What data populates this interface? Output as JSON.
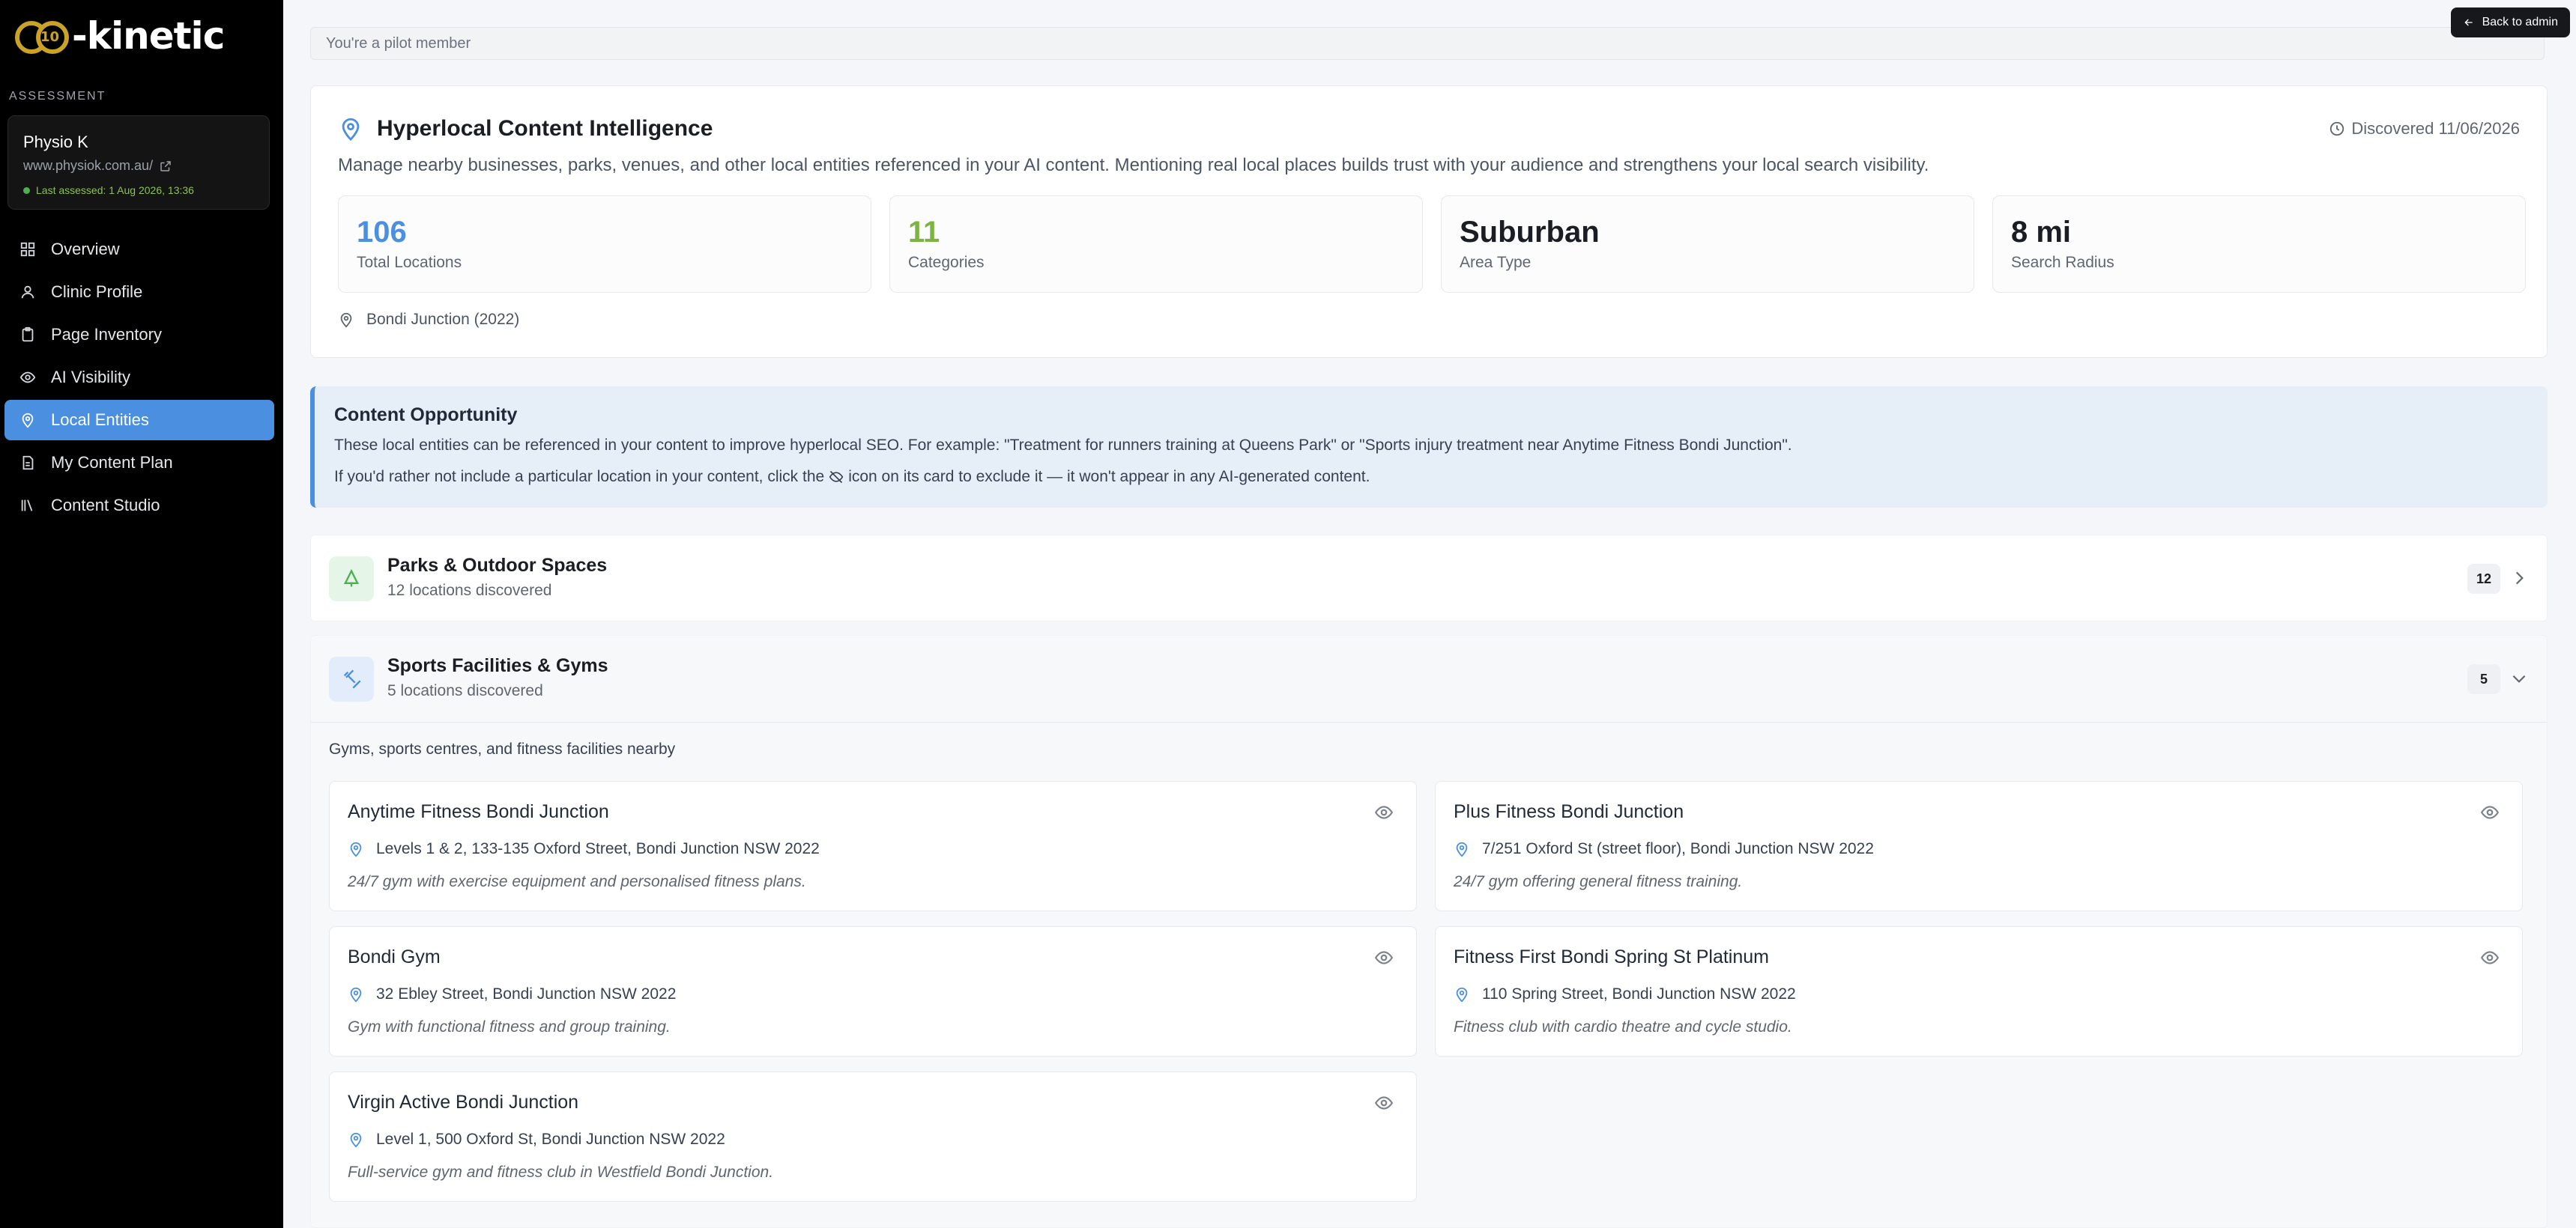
{
  "brand": {
    "logo_mark": "10",
    "logo_text": "-kinetic"
  },
  "sidebar": {
    "section_label": "ASSESSMENT",
    "site": {
      "name": "Physio K",
      "url": "www.physiok.com.au/",
      "assessed": "Last assessed: 1 Aug 2026, 13:36"
    },
    "items": [
      {
        "label": "Overview",
        "icon": "grid-icon"
      },
      {
        "label": "Clinic Profile",
        "icon": "user-icon"
      },
      {
        "label": "Page Inventory",
        "icon": "clipboard-icon"
      },
      {
        "label": "AI Visibility",
        "icon": "eye-icon"
      },
      {
        "label": "Local Entities",
        "icon": "map-pin-icon",
        "active": true
      },
      {
        "label": "My Content Plan",
        "icon": "document-icon"
      },
      {
        "label": "Content Studio",
        "icon": "library-icon"
      }
    ]
  },
  "topbar": {
    "pilot_text": "You're a pilot member",
    "back_label": "Back to admin"
  },
  "intel": {
    "title": "Hyperlocal Content Intelligence",
    "discovered": "Discovered 11/06/2026",
    "description": "Manage nearby businesses, parks, venues, and other local entities referenced in your AI content. Mentioning real local places builds trust with your audience and strengthens your local search visibility.",
    "stats": [
      {
        "value": "106",
        "label": "Total Locations"
      },
      {
        "value": "11",
        "label": "Categories"
      },
      {
        "value": "Suburban",
        "label": "Area Type"
      },
      {
        "value": "8 mi",
        "label": "Search Radius"
      }
    ],
    "location": "Bondi Junction (2022)"
  },
  "opportunity": {
    "title": "Content Opportunity",
    "text": "These local entities can be referenced in your content to improve hyperlocal SEO. For example: \"Treatment for runners training at Queens Park\" or \"Sports injury treatment near Anytime Fitness Bondi Junction\".",
    "text2_before": "If you'd rather not include a particular location in your content, click the",
    "text2_after": "icon on its card to exclude it — it won't appear in any AI-generated content."
  },
  "categories": {
    "parks": {
      "title": "Parks & Outdoor Spaces",
      "sub": "12 locations discovered",
      "count": "12"
    },
    "sports": {
      "title": "Sports Facilities & Gyms",
      "sub": "5 locations discovered",
      "count": "5",
      "description": "Gyms, sports centres, and fitness facilities nearby",
      "entities": [
        {
          "name": "Anytime Fitness Bondi Junction",
          "address": "Levels 1 & 2, 133-135 Oxford Street, Bondi Junction NSW 2022",
          "desc": "24/7 gym with exercise equipment and personalised fitness plans."
        },
        {
          "name": "Plus Fitness Bondi Junction",
          "address": "7/251 Oxford St (street floor), Bondi Junction NSW 2022",
          "desc": "24/7 gym offering general fitness training."
        },
        {
          "name": "Bondi Gym",
          "address": "32 Ebley Street, Bondi Junction NSW 2022",
          "desc": "Gym with functional fitness and group training."
        },
        {
          "name": "Fitness First Bondi Spring St Platinum",
          "address": "110 Spring Street, Bondi Junction NSW 2022",
          "desc": "Fitness club with cardio theatre and cycle studio."
        },
        {
          "name": "Virgin Active Bondi Junction",
          "address": "Level 1, 500 Oxford St, Bondi Junction NSW 2022",
          "desc": "Full-service gym and fitness club in Westfield Bondi Junction."
        }
      ]
    }
  },
  "colors": {
    "accent": "#4a8fe0",
    "green": "#7cb342",
    "sidebar": "#000000"
  }
}
